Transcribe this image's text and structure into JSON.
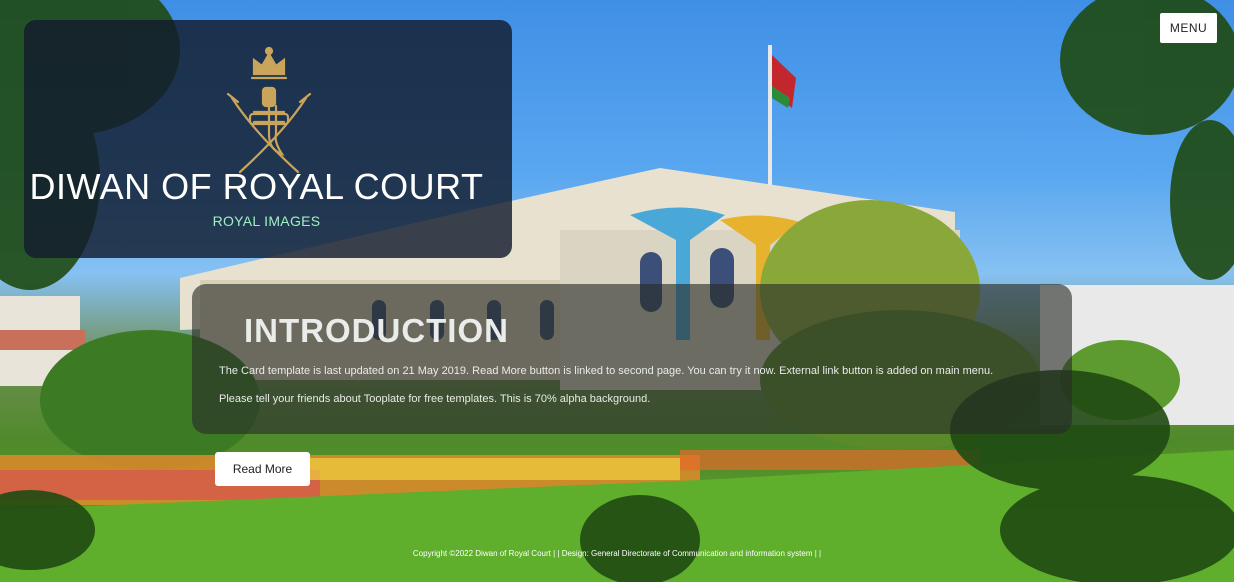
{
  "header": {
    "menu_label": "MENU"
  },
  "brand": {
    "title": "DIWAN OF ROYAL COURT",
    "subtitle": "ROYAL IMAGES",
    "emblem_icon": "oman-khanjar-emblem"
  },
  "intro": {
    "heading": "INTRODUCTION",
    "paragraph1": "The Card template is last updated on 21 May 2019. Read More button is linked to second page. You can try it now. External link button is added on main menu.",
    "paragraph2": "Please tell your friends about Tooplate for free templates. This is 70% alpha background.",
    "read_more_label": "Read More"
  },
  "footer": {
    "copyright": "Copyright ©2022 Diwan of Royal Court",
    "separator1": " | | ",
    "design_credit": "Design: General Directorate of Communication and information system",
    "separator2": " | |"
  },
  "colors": {
    "brand_card_bg": "#121c2d",
    "subtitle_accent": "#9ff0c4",
    "button_bg": "#ffffff"
  }
}
